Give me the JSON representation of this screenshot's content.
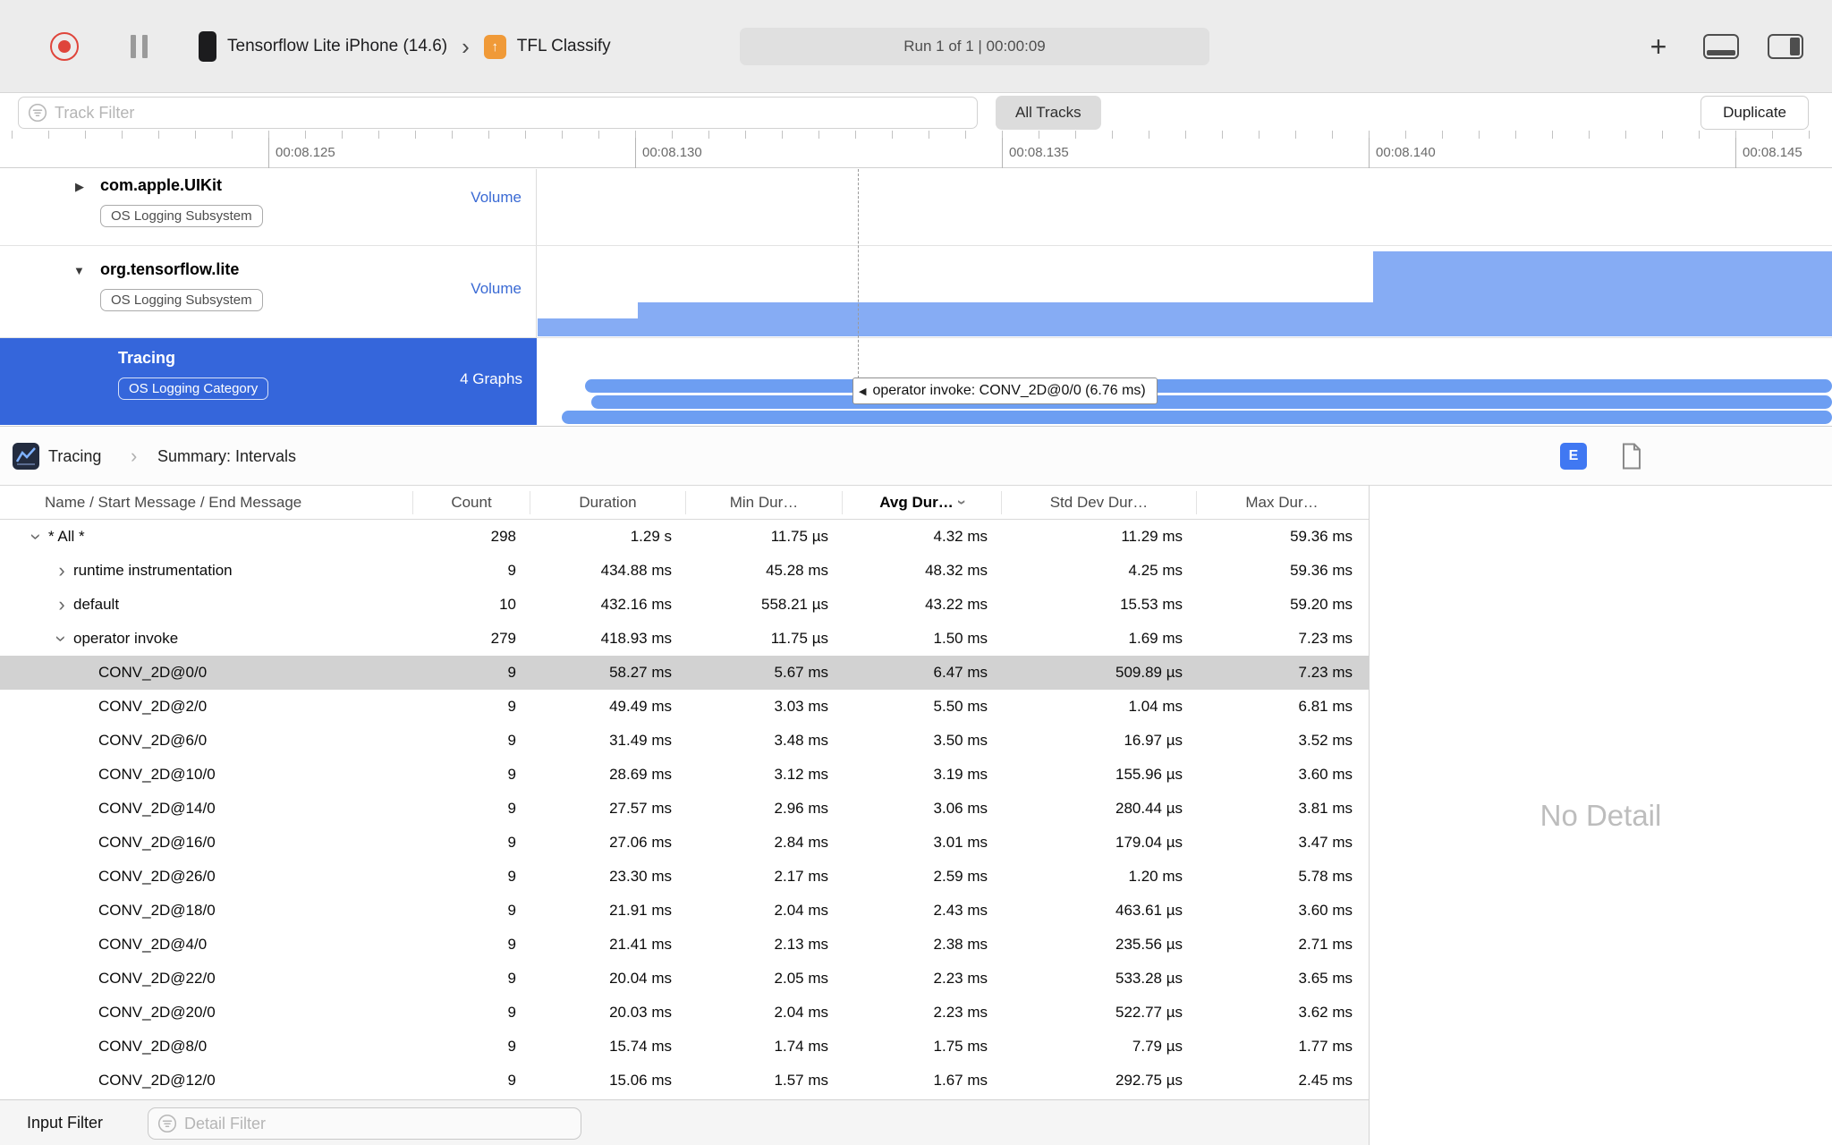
{
  "toolbar": {
    "device_name": "Tensorflow Lite iPhone (14.6)",
    "app_name": "TFL Classify",
    "run_status": "Run 1 of 1  |  00:00:09"
  },
  "filter_bar": {
    "track_filter_placeholder": "Track Filter",
    "all_tracks": "All Tracks",
    "duplicate": "Duplicate"
  },
  "ruler": {
    "labels": [
      "00:08.125",
      "00:08.130",
      "00:08.135",
      "00:08.140",
      "00:08.145"
    ]
  },
  "tracks": [
    {
      "name": "com.apple.UIKit",
      "badge": "OS Logging Subsystem",
      "meta": "Volume",
      "selected": false
    },
    {
      "name": "org.tensorflow.lite",
      "badge": "OS Logging Subsystem",
      "meta": "Volume",
      "selected": false
    },
    {
      "name": "Tracing",
      "badge": "OS Logging Category",
      "meta": "4 Graphs",
      "selected": true
    }
  ],
  "timeline_tooltip": "operator invoke: CONV_2D@0/0 (6.76 ms)",
  "detail": {
    "breadcrumb": {
      "instrument": "Tracing",
      "page": "Summary: Intervals"
    },
    "e_button": "E",
    "no_detail": "No Detail",
    "bottom": {
      "label": "Input Filter",
      "filter_placeholder": "Detail Filter"
    }
  },
  "table": {
    "columns": {
      "name": "Name / Start Message / End Message",
      "count": "Count",
      "duration": "Duration",
      "min": "Min Dur…",
      "avg": "Avg Dur…",
      "std": "Std Dev Dur…",
      "max": "Max Dur…"
    },
    "sort_column": "avg",
    "rows": [
      {
        "level": 0,
        "expander": "down",
        "selected": false,
        "name": "* All *",
        "count": "298",
        "duration": "1.29 s",
        "min": "11.75 µs",
        "avg": "4.32 ms",
        "std": "11.29 ms",
        "max": "59.36 ms"
      },
      {
        "level": 1,
        "expander": "right",
        "selected": false,
        "name": "runtime instrumentation",
        "count": "9",
        "duration": "434.88 ms",
        "min": "45.28 ms",
        "avg": "48.32 ms",
        "std": "4.25 ms",
        "max": "59.36 ms"
      },
      {
        "level": 1,
        "expander": "right",
        "selected": false,
        "name": "default",
        "count": "10",
        "duration": "432.16 ms",
        "min": "558.21 µs",
        "avg": "43.22 ms",
        "std": "15.53 ms",
        "max": "59.20 ms"
      },
      {
        "level": 1,
        "expander": "down",
        "selected": false,
        "name": "operator invoke",
        "count": "279",
        "duration": "418.93 ms",
        "min": "11.75 µs",
        "avg": "1.50 ms",
        "std": "1.69 ms",
        "max": "7.23 ms"
      },
      {
        "level": 2,
        "expander": "none",
        "selected": true,
        "name": "CONV_2D@0/0",
        "count": "9",
        "duration": "58.27 ms",
        "min": "5.67 ms",
        "avg": "6.47 ms",
        "std": "509.89 µs",
        "max": "7.23 ms"
      },
      {
        "level": 2,
        "expander": "none",
        "selected": false,
        "name": "CONV_2D@2/0",
        "count": "9",
        "duration": "49.49 ms",
        "min": "3.03 ms",
        "avg": "5.50 ms",
        "std": "1.04 ms",
        "max": "6.81 ms"
      },
      {
        "level": 2,
        "expander": "none",
        "selected": false,
        "name": "CONV_2D@6/0",
        "count": "9",
        "duration": "31.49 ms",
        "min": "3.48 ms",
        "avg": "3.50 ms",
        "std": "16.97 µs",
        "max": "3.52 ms"
      },
      {
        "level": 2,
        "expander": "none",
        "selected": false,
        "name": "CONV_2D@10/0",
        "count": "9",
        "duration": "28.69 ms",
        "min": "3.12 ms",
        "avg": "3.19 ms",
        "std": "155.96 µs",
        "max": "3.60 ms"
      },
      {
        "level": 2,
        "expander": "none",
        "selected": false,
        "name": "CONV_2D@14/0",
        "count": "9",
        "duration": "27.57 ms",
        "min": "2.96 ms",
        "avg": "3.06 ms",
        "std": "280.44 µs",
        "max": "3.81 ms"
      },
      {
        "level": 2,
        "expander": "none",
        "selected": false,
        "name": "CONV_2D@16/0",
        "count": "9",
        "duration": "27.06 ms",
        "min": "2.84 ms",
        "avg": "3.01 ms",
        "std": "179.04 µs",
        "max": "3.47 ms"
      },
      {
        "level": 2,
        "expander": "none",
        "selected": false,
        "name": "CONV_2D@26/0",
        "count": "9",
        "duration": "23.30 ms",
        "min": "2.17 ms",
        "avg": "2.59 ms",
        "std": "1.20 ms",
        "max": "5.78 ms"
      },
      {
        "level": 2,
        "expander": "none",
        "selected": false,
        "name": "CONV_2D@18/0",
        "count": "9",
        "duration": "21.91 ms",
        "min": "2.04 ms",
        "avg": "2.43 ms",
        "std": "463.61 µs",
        "max": "3.60 ms"
      },
      {
        "level": 2,
        "expander": "none",
        "selected": false,
        "name": "CONV_2D@4/0",
        "count": "9",
        "duration": "21.41 ms",
        "min": "2.13 ms",
        "avg": "2.38 ms",
        "std": "235.56 µs",
        "max": "2.71 ms"
      },
      {
        "level": 2,
        "expander": "none",
        "selected": false,
        "name": "CONV_2D@22/0",
        "count": "9",
        "duration": "20.04 ms",
        "min": "2.05 ms",
        "avg": "2.23 ms",
        "std": "533.28 µs",
        "max": "3.65 ms"
      },
      {
        "level": 2,
        "expander": "none",
        "selected": false,
        "name": "CONV_2D@20/0",
        "count": "9",
        "duration": "20.03 ms",
        "min": "2.04 ms",
        "avg": "2.23 ms",
        "std": "522.77 µs",
        "max": "3.62 ms"
      },
      {
        "level": 2,
        "expander": "none",
        "selected": false,
        "name": "CONV_2D@8/0",
        "count": "9",
        "duration": "15.74 ms",
        "min": "1.74 ms",
        "avg": "1.75 ms",
        "std": "7.79 µs",
        "max": "1.77 ms"
      },
      {
        "level": 2,
        "expander": "none",
        "selected": false,
        "name": "CONV_2D@12/0",
        "count": "9",
        "duration": "15.06 ms",
        "min": "1.57 ms",
        "avg": "1.67 ms",
        "std": "292.75 µs",
        "max": "2.45 ms"
      }
    ]
  },
  "colors": {
    "record_red": "#df453b",
    "selection_blue": "#3566db",
    "interval_bar_blue": "#6d9ef2",
    "volume_area_blue": "#86acf4",
    "link_blue": "#3a6ad4",
    "selected_row_gray": "#d2d2d2"
  }
}
